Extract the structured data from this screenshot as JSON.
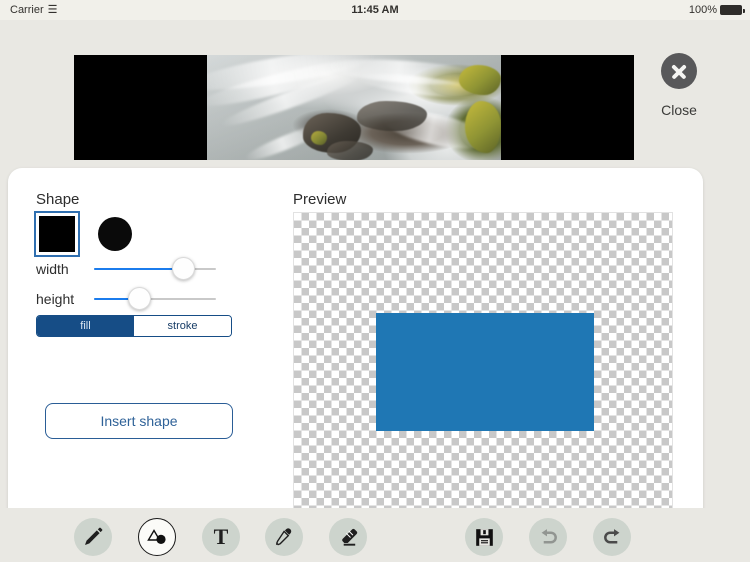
{
  "status_bar": {
    "carrier": "Carrier",
    "wifi_icon": "wifi-icon",
    "time": "11:45 AM",
    "battery_percent": "100%",
    "battery_icon": "battery-full-icon"
  },
  "canvas": {
    "image_description": "waterfall-photo",
    "letterbox_color": "#000000"
  },
  "close": {
    "label": "Close",
    "icon": "close-circle-icon"
  },
  "panel": {
    "shape_heading": "Shape",
    "preview_heading": "Preview",
    "shapes": [
      {
        "name": "square",
        "selected": true,
        "color": "#000000"
      },
      {
        "name": "circle",
        "selected": false,
        "color": "#0a0a0a"
      }
    ],
    "sliders": [
      {
        "label": "width",
        "value": 75
      },
      {
        "label": "height",
        "value": 38
      }
    ],
    "segmented": {
      "options": [
        "fill",
        "stroke"
      ],
      "selected": "fill",
      "accent": "#164d86"
    },
    "insert_button_label": "Insert shape"
  },
  "preview": {
    "shape_color": "#1f77b4",
    "background": "transparent-checkerboard"
  },
  "toolbar": {
    "tools": [
      {
        "name": "pencil-tool",
        "icon": "pencil-icon",
        "selected": false,
        "enabled": true
      },
      {
        "name": "shapes-tool",
        "icon": "shapes-icon",
        "selected": true,
        "enabled": true
      },
      {
        "name": "text-tool",
        "icon": "text-t-icon",
        "label": "T",
        "selected": false,
        "enabled": true
      },
      {
        "name": "color-picker-tool",
        "icon": "eyedropper-icon",
        "selected": false,
        "enabled": true
      },
      {
        "name": "eraser-tool",
        "icon": "eraser-icon",
        "selected": false,
        "enabled": true
      },
      {
        "name": "save-action",
        "icon": "floppy-disk-icon",
        "selected": false,
        "enabled": true
      },
      {
        "name": "undo-action",
        "icon": "undo-arrow-icon",
        "selected": false,
        "enabled": false
      },
      {
        "name": "redo-action",
        "icon": "redo-arrow-icon",
        "selected": false,
        "enabled": true
      }
    ]
  }
}
